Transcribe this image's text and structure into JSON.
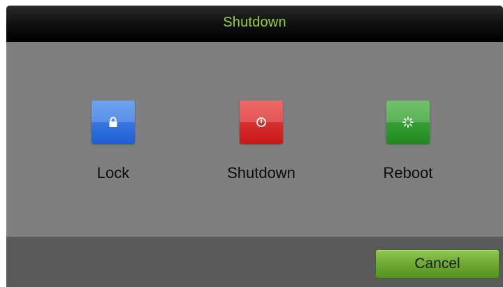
{
  "dialog": {
    "title": "Shutdown",
    "actions": [
      {
        "label": "Lock",
        "icon": "lock-icon",
        "color": "#1e5fd3"
      },
      {
        "label": "Shutdown",
        "icon": "power-icon",
        "color": "#c61818"
      },
      {
        "label": "Reboot",
        "icon": "reboot-icon",
        "color": "#1f8a1e"
      }
    ],
    "cancel_label": "Cancel",
    "title_color": "#9bd13c"
  }
}
